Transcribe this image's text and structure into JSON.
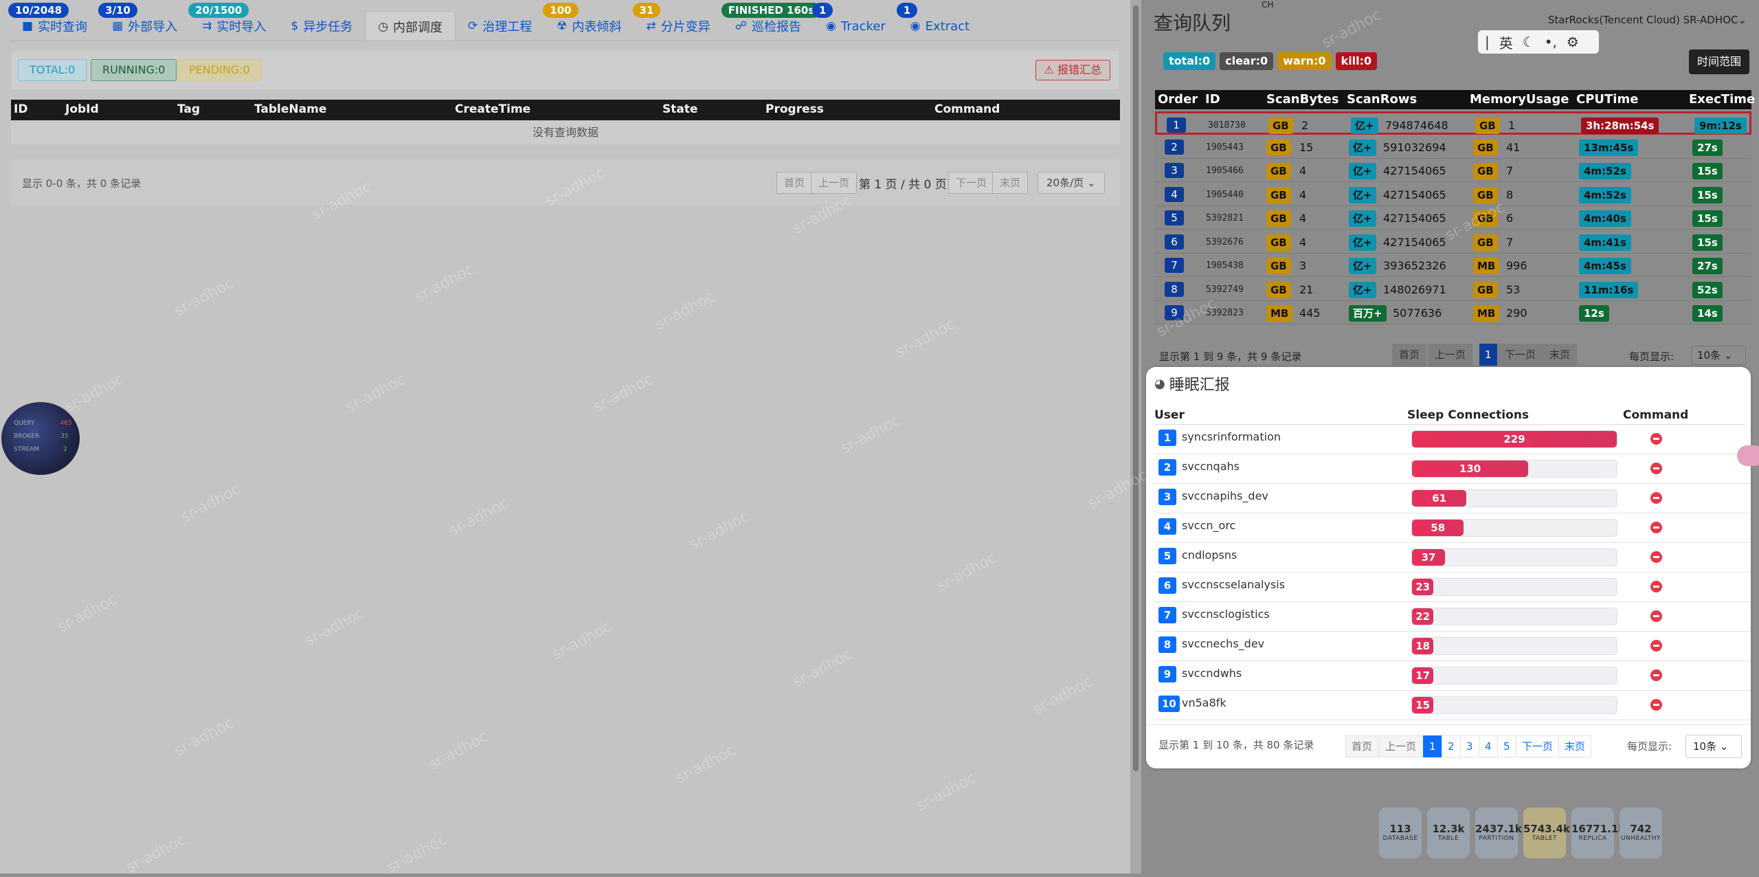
{
  "tabs": [
    {
      "label": "实时查询",
      "icon": "db-icon",
      "badge": "10/2048",
      "badge_color": "blue"
    },
    {
      "label": "外部导入",
      "icon": "chart-icon",
      "badge": "3/10",
      "badge_color": "blue"
    },
    {
      "label": "实时导入",
      "icon": "import-icon",
      "badge": "20/1500",
      "badge_color": "teal"
    },
    {
      "label": "异步任务",
      "icon": "dollar-icon",
      "badge": "",
      "badge_color": ""
    },
    {
      "label": "内部调度",
      "icon": "clock-icon",
      "badge": "",
      "badge_color": "",
      "active": true
    },
    {
      "label": "治理工程",
      "icon": "refresh-icon",
      "badge": "",
      "badge_color": ""
    },
    {
      "label": "内表倾斜",
      "icon": "radiation-icon",
      "badge": "100",
      "badge_color": "amber"
    },
    {
      "label": "分片变异",
      "icon": "shuffle-icon",
      "badge": "31",
      "badge_color": "amber"
    },
    {
      "label": "巡检报告",
      "icon": "report-icon",
      "badge": "FINISHED 160s",
      "badge_color": "green"
    },
    {
      "label": "Tracker",
      "icon": "tracker-icon",
      "badge": "1",
      "badge_color": "blue"
    },
    {
      "label": "Extract",
      "icon": "extract-icon",
      "badge": "1",
      "badge_color": "blue"
    }
  ],
  "status": {
    "total": "TOTAL:0",
    "running": "RUNNING:0",
    "pending": "PENDING:0",
    "error_btn": "报错汇总"
  },
  "jobs_table": {
    "columns": [
      "ID",
      "JobId",
      "Tag",
      "TableName",
      "CreateTime",
      "State",
      "Progress",
      "Command"
    ],
    "empty": "没有查询数据"
  },
  "left_pager": {
    "summary": "显示 0-0 条，共 0 条记录",
    "first": "首页",
    "prev": "上一页",
    "pageinfo": "第 1 页 / 共 0 页",
    "next": "下一页",
    "last": "末页",
    "per_page": "20条/页"
  },
  "gauge": {
    "l1": "QUERY",
    "v1": "465",
    "l2": "BROKER",
    "v2": "35",
    "l3": "STREAM",
    "v3": "2"
  },
  "right": {
    "title": "查询队列",
    "cluster": "StarRocks(Tencent Cloud) SR-ADHOC",
    "ime_top": "CH",
    "ime_lang": "英",
    "chips": {
      "total": "total:0",
      "clear": "clear:0",
      "warn": "warn:0",
      "kill": "kill:0"
    },
    "time_range": "时间范围",
    "columns": [
      "Order",
      "ID",
      "ScanBytes",
      "ScanRows",
      "MemoryUsage",
      "CPUTime",
      "ExecTime"
    ],
    "rows": [
      {
        "order": "1",
        "id": "3018730",
        "sb_unit": "GB",
        "sb": "2",
        "sr_unit": "亿+",
        "sr": "794874648",
        "mu_unit": "GB",
        "mu": "1",
        "cpu": "3h:28m:54s",
        "cpu_c": "red",
        "exec": "9m:12s",
        "exec_c": "cyan"
      },
      {
        "order": "2",
        "id": "1905443",
        "sb_unit": "GB",
        "sb": "15",
        "sr_unit": "亿+",
        "sr": "591032694",
        "mu_unit": "GB",
        "mu": "41",
        "cpu": "13m:45s",
        "cpu_c": "cyan",
        "exec": "27s",
        "exec_c": "green"
      },
      {
        "order": "3",
        "id": "1905466",
        "sb_unit": "GB",
        "sb": "4",
        "sr_unit": "亿+",
        "sr": "427154065",
        "mu_unit": "GB",
        "mu": "7",
        "cpu": "4m:52s",
        "cpu_c": "cyan",
        "exec": "15s",
        "exec_c": "green"
      },
      {
        "order": "4",
        "id": "1905440",
        "sb_unit": "GB",
        "sb": "4",
        "sr_unit": "亿+",
        "sr": "427154065",
        "mu_unit": "GB",
        "mu": "8",
        "cpu": "4m:52s",
        "cpu_c": "cyan",
        "exec": "15s",
        "exec_c": "green"
      },
      {
        "order": "5",
        "id": "5392821",
        "sb_unit": "GB",
        "sb": "4",
        "sr_unit": "亿+",
        "sr": "427154065",
        "mu_unit": "GB",
        "mu": "6",
        "cpu": "4m:40s",
        "cpu_c": "cyan",
        "exec": "15s",
        "exec_c": "green"
      },
      {
        "order": "6",
        "id": "5392676",
        "sb_unit": "GB",
        "sb": "4",
        "sr_unit": "亿+",
        "sr": "427154065",
        "mu_unit": "GB",
        "mu": "7",
        "cpu": "4m:41s",
        "cpu_c": "cyan",
        "exec": "15s",
        "exec_c": "green"
      },
      {
        "order": "7",
        "id": "1905438",
        "sb_unit": "GB",
        "sb": "3",
        "sr_unit": "亿+",
        "sr": "393652326",
        "mu_unit": "MB",
        "mu": "996",
        "cpu": "4m:45s",
        "cpu_c": "cyan",
        "exec": "27s",
        "exec_c": "green"
      },
      {
        "order": "8",
        "id": "5392749",
        "sb_unit": "GB",
        "sb": "21",
        "sr_unit": "亿+",
        "sr": "148026971",
        "mu_unit": "GB",
        "mu": "53",
        "cpu": "11m:16s",
        "cpu_c": "cyan",
        "exec": "52s",
        "exec_c": "green"
      },
      {
        "order": "9",
        "id": "5392823",
        "sb_unit": "MB",
        "sb": "445",
        "sr_unit": "百万+",
        "sr": "5077636",
        "mu_unit": "MB",
        "mu": "290",
        "cpu": "12s",
        "cpu_c": "green",
        "exec": "14s",
        "exec_c": "green"
      }
    ],
    "footer": {
      "summary": "显示第 1 到 9 条，共 9 条记录",
      "first": "首页",
      "prev": "上一页",
      "page": "1",
      "next": "下一页",
      "last": "末页",
      "per_label": "每页显示:",
      "per": "10条"
    }
  },
  "sleep": {
    "title": "睡眠汇报",
    "columns": [
      "User",
      "Sleep Connections",
      "Command"
    ],
    "max": 229,
    "rows": [
      {
        "rank": "1",
        "user": "syncsrinformation",
        "value": 229
      },
      {
        "rank": "2",
        "user": "svccnqahs",
        "value": 130
      },
      {
        "rank": "3",
        "user": "svccnapihs_dev",
        "value": 61
      },
      {
        "rank": "4",
        "user": "svccn_orc",
        "value": 58
      },
      {
        "rank": "5",
        "user": "cndlopsns",
        "value": 37
      },
      {
        "rank": "6",
        "user": "svccnscselanalysis",
        "value": 23
      },
      {
        "rank": "7",
        "user": "svccnsclogistics",
        "value": 22
      },
      {
        "rank": "8",
        "user": "svccnechs_dev",
        "value": 18
      },
      {
        "rank": "9",
        "user": "svccndwhs",
        "value": 17
      },
      {
        "rank": "10",
        "user": "vn5a8fk",
        "value": 15
      }
    ],
    "footer": {
      "summary": "显示第 1 到 10 条，共 80 条记录",
      "first": "首页",
      "prev": "上一页",
      "pages": [
        "1",
        "2",
        "3",
        "4",
        "5"
      ],
      "next": "下一页",
      "last": "末页",
      "per_label": "每页显示:",
      "per": "10条"
    }
  },
  "stats": [
    {
      "value": "113",
      "label": "DATABASE"
    },
    {
      "value": "12.3k",
      "label": "TABLE"
    },
    {
      "value": "2437.1k",
      "label": "PARTITION"
    },
    {
      "value": "5743.4k",
      "label": "TABLET"
    },
    {
      "value": "16771.1k",
      "label": "REPLICA"
    },
    {
      "value": "742",
      "label": "UNHEALTHY"
    }
  ],
  "watermark": "sr-adhoc"
}
